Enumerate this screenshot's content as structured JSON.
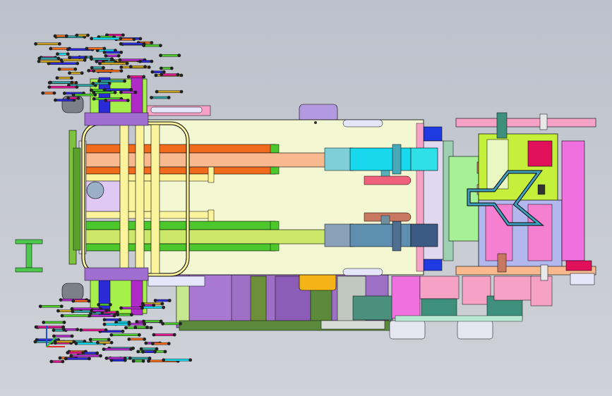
{
  "viewport": {
    "background_top": "#bcc1cb",
    "background_bottom": "#cfd2d8",
    "edge_color": "#000000"
  },
  "icons": {
    "triad": "coordinate-triad-icon"
  },
  "palette": {
    "chassis": "#f3f8d2",
    "wheel_hub_blue": "#2a2ad8",
    "wheel_hub_lime": "#a6f04c",
    "wheel_hub_magenta": "#b02ac8",
    "motor_grey": "#7c8088",
    "bumper_yellow": "#fbf49c",
    "rail_orange": "#f06b1c",
    "rail_peach": "#f7b98d",
    "rail_green": "#4cc82c",
    "rail_yellow_green": "#cbe86a",
    "cylinder_cyan": "#17d8ec",
    "cylinder_steel": "#5f8fb0",
    "cylinder_navy": "#3b5a84",
    "purple_block": "#9d6fc5",
    "lime_plate": "#c4f03c",
    "pink_plate": "#f57fd0",
    "lavender_plate": "#b2a2ec",
    "light_pink": "#f5a2c6",
    "teal": "#3f8f7d",
    "slot": "#e6e6fa"
  }
}
